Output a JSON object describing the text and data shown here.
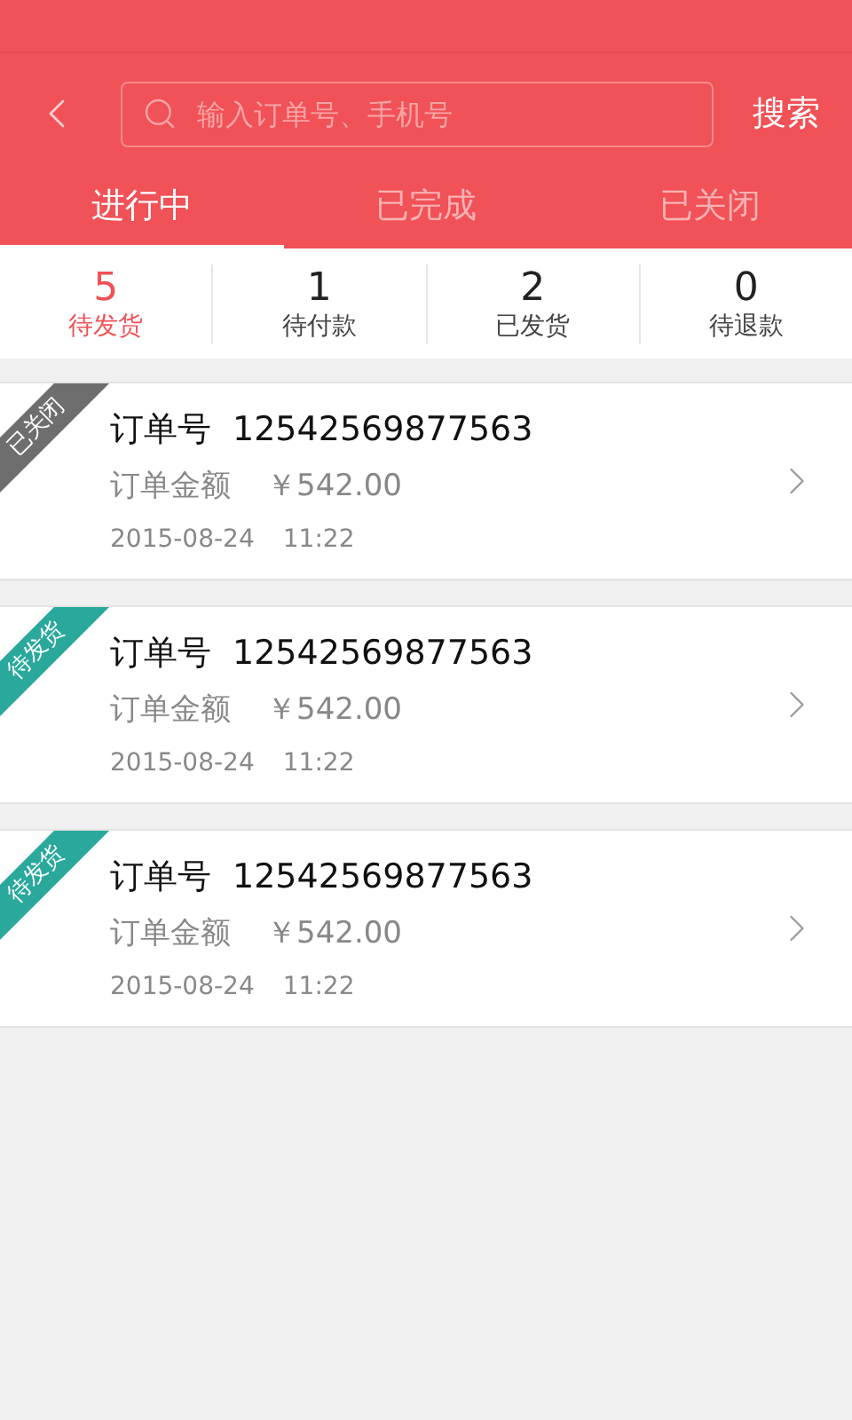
{
  "search": {
    "placeholder": "输入订单号、手机号",
    "button": "搜索"
  },
  "tabs": [
    {
      "label": "进行中",
      "selected": true
    },
    {
      "label": "已完成",
      "selected": false
    },
    {
      "label": "已关闭",
      "selected": false
    }
  ],
  "counters": [
    {
      "count": "5",
      "label": "待发货",
      "selected": true
    },
    {
      "count": "1",
      "label": "待付款",
      "selected": false
    },
    {
      "count": "2",
      "label": "已发货",
      "selected": false
    },
    {
      "count": "0",
      "label": "待退款",
      "selected": false
    }
  ],
  "orders": [
    {
      "status": "已关闭",
      "color": "#6e6e6e",
      "order_label": "订单号",
      "order_no": "12542569877563",
      "amount_label": "订单金额",
      "amount": "￥542.00",
      "date": "2015-08-24",
      "time": "11:22"
    },
    {
      "status": "待发货",
      "color": "#2aa89c",
      "order_label": "订单号",
      "order_no": "12542569877563",
      "amount_label": "订单金额",
      "amount": "￥542.00",
      "date": "2015-08-24",
      "time": "11:22"
    },
    {
      "status": "待发货",
      "color": "#2aa89c",
      "order_label": "订单号",
      "order_no": "12542569877563",
      "amount_label": "订单金额",
      "amount": "￥542.00",
      "date": "2015-08-24",
      "time": "11:22"
    }
  ]
}
